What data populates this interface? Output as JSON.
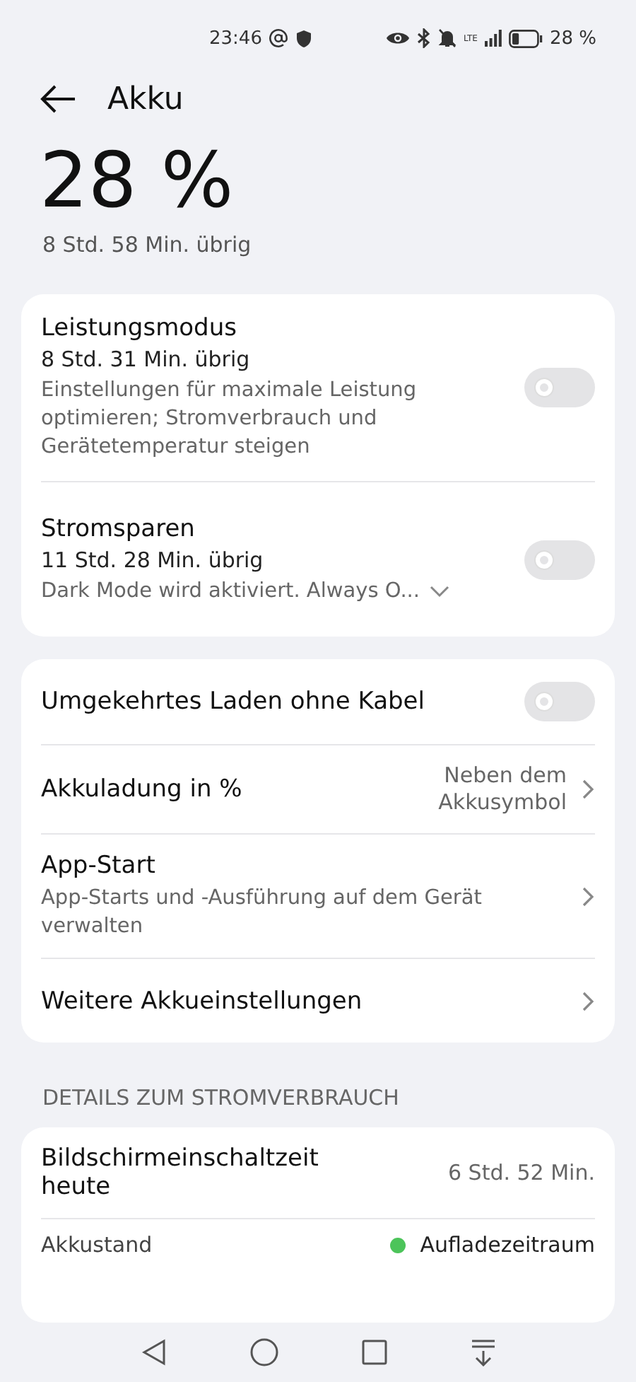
{
  "status_bar": {
    "time": "23:46",
    "network": "LTE",
    "battery": "28 %"
  },
  "header": {
    "title": "Akku"
  },
  "battery": {
    "percent": "28 %",
    "remaining": "8 Std. 58 Min. übrig"
  },
  "modes": [
    {
      "kind": "toggle",
      "title": "Leistungsmodus",
      "subtitle": "8 Std. 31 Min. übrig",
      "description": "Einstellungen für maximale Leistung optimieren; Stromverbrauch und Gerätetemperatur steigen",
      "on": false,
      "expandable": false
    },
    {
      "kind": "toggle",
      "title": "Stromsparen",
      "subtitle": "11 Std. 28 Min. übrig",
      "description": "Dark Mode wird aktiviert. Always O...",
      "on": false,
      "expandable": true
    }
  ],
  "settings": [
    {
      "kind": "toggle",
      "title": "Umgekehrtes Laden ohne Kabel",
      "on": false
    },
    {
      "kind": "value",
      "title": "Akkuladung in %",
      "value": "Neben dem Akkusymbol"
    },
    {
      "kind": "link",
      "title": "App-Start",
      "description": "App-Starts und -Ausführung auf dem Gerät verwalten"
    },
    {
      "kind": "link",
      "title": "Weitere Akkueinstellungen"
    }
  ],
  "details": {
    "heading": "DETAILS ZUM STROMVERBRAUCH",
    "screen_time": {
      "label": "Bildschirmeinschaltzeit heute",
      "value": "6 Std. 52 Min."
    },
    "legend": {
      "label": "Akkustand",
      "item": "Aufladezeitraum",
      "color": "#4cc45a"
    }
  }
}
